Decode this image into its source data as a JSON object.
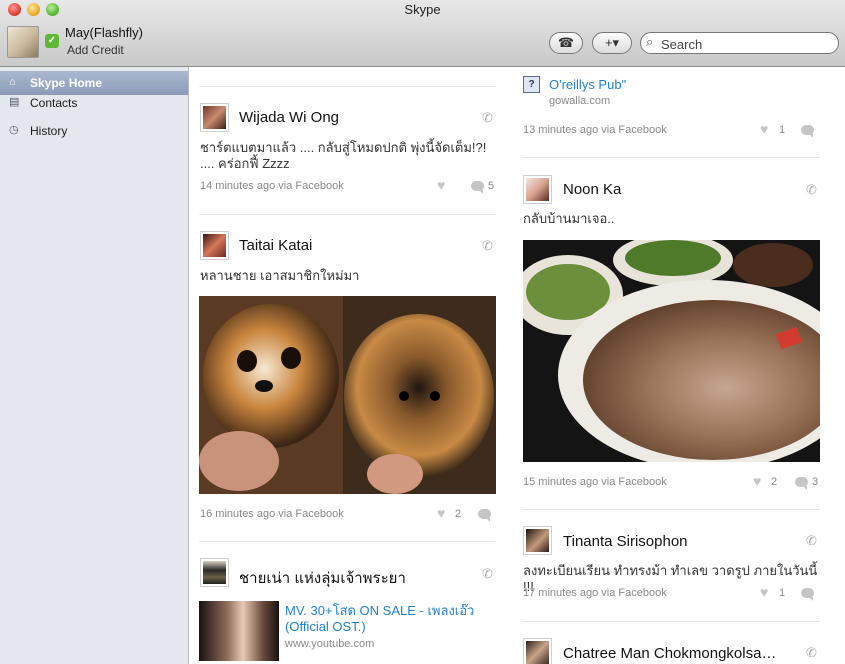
{
  "window": {
    "title": "Skype"
  },
  "profile": {
    "name": "May(Flashfly)",
    "add_credit": "Add Credit"
  },
  "toolbar": {
    "dialpad_icon": "dialpad-icon",
    "add_label": "+▾"
  },
  "search": {
    "placeholder": "Search"
  },
  "sidebar": {
    "items": [
      {
        "label": "Skype Home",
        "icon": "home-icon"
      },
      {
        "label": "Contacts",
        "icon": "contacts-book-icon"
      },
      {
        "label": "History",
        "icon": "clock-icon"
      }
    ]
  },
  "colors": {
    "link": "#1f7fd1",
    "sidebar_bg": "#e4e8ee",
    "selected": "#8c9cb9",
    "status_green": "#5fb833"
  },
  "feed": {
    "left": [
      {
        "name": "Wijada Wi Ong",
        "text": "ชาร์ตแบตมาแล้ว .... กลับสู่โหมดปกติ พุ่งนี้จัดเต็ม!?! .... คร่อกฟี้ Zzzz",
        "meta": "14 minutes ago via Facebook",
        "likes": "",
        "comments": "5"
      },
      {
        "name": "Taitai Katai",
        "text": "หลานชาย เอาสมาชิกใหม่มา",
        "meta": "16 minutes ago via Facebook",
        "likes": "2",
        "comments": "",
        "image": "two-puppies-photo"
      },
      {
        "name": "ชายเน่า แห่งลุ่มเจ้าพระยา",
        "link_title": "MV. 30+โสด ON SALE - เพลงเอ๊ว (Official OST.)",
        "link_domain": "www.youtube.com"
      }
    ],
    "right": [
      {
        "link_title": "O'reillys Pub\"",
        "link_domain": "gowalla.com",
        "meta": "13 minutes ago via Facebook",
        "likes": "1",
        "comments": ""
      },
      {
        "name": "Noon Ka",
        "text": "กลับบ้านมาเจอ..",
        "meta": "15 minutes ago via Facebook",
        "likes": "2",
        "comments": "3",
        "image": "grilled-pork-photo"
      },
      {
        "name": "Tinanta Sirisophon",
        "text": "ลงทะเบียนเรียน ทำทรงม้า ทำเลข วาดรูป ภายในวันนี้ !!!",
        "meta": "17 minutes ago via Facebook",
        "likes": "1",
        "comments": ""
      },
      {
        "name": "Chatree Man Chokmongkolsa…"
      }
    ]
  }
}
